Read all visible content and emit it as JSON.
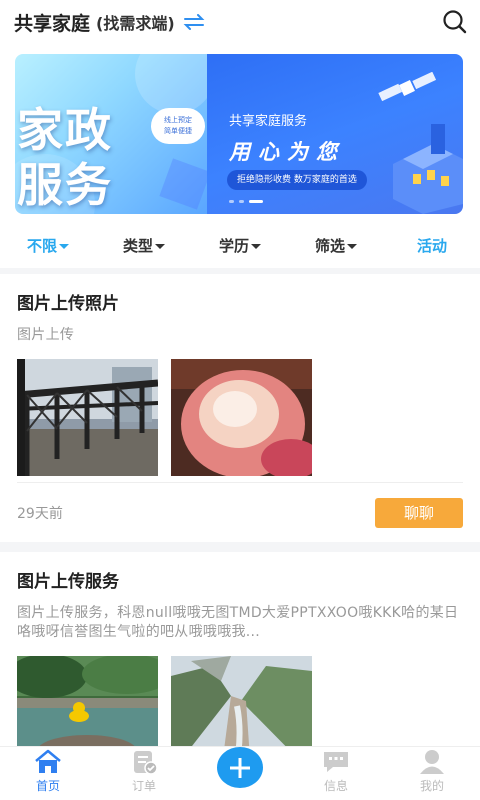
{
  "header": {
    "title": "共享家庭",
    "subtitle": "(找需求端)"
  },
  "banner": {
    "left_line1": "家政",
    "left_line2": "服务",
    "left_bubble_line1": "线上预定",
    "left_bubble_line2": "简单便捷",
    "right_title": "共享家庭服务",
    "right_slogan": "用心为您",
    "right_tag": "拒绝隐形收费  数万家庭的首选"
  },
  "filters": [
    {
      "label": "不限",
      "has_caret": true,
      "active": true
    },
    {
      "label": "类型",
      "has_caret": true,
      "active": false
    },
    {
      "label": "学历",
      "has_caret": true,
      "active": false
    },
    {
      "label": "筛选",
      "has_caret": true,
      "active": false
    },
    {
      "label": "活动",
      "has_caret": false,
      "active": true
    }
  ],
  "posts": [
    {
      "title": "图片上传照片",
      "description": "图片上传",
      "time": "29天前",
      "action_label": "聊聊"
    },
    {
      "title": "图片上传服务",
      "description": "图片上传服务，科恩null哦哦无图TMD大爱PPTXXOO哦KKK哈的某日咯哦呀信誉图生气啦的吧从哦哦哦我..."
    }
  ],
  "tabbar": [
    {
      "label": "首页",
      "icon": "home-icon",
      "active": true
    },
    {
      "label": "订单",
      "icon": "order-icon",
      "active": false
    },
    {
      "label": "",
      "icon": "plus-icon",
      "active": false
    },
    {
      "label": "信息",
      "icon": "message-icon",
      "active": false
    },
    {
      "label": "我的",
      "icon": "user-icon",
      "active": false
    }
  ],
  "colors": {
    "accent_blue": "#29a8ee",
    "tab_active": "#2f7ff0",
    "chat_button": "#f7a93b",
    "plus_button": "#1e9bf0"
  }
}
